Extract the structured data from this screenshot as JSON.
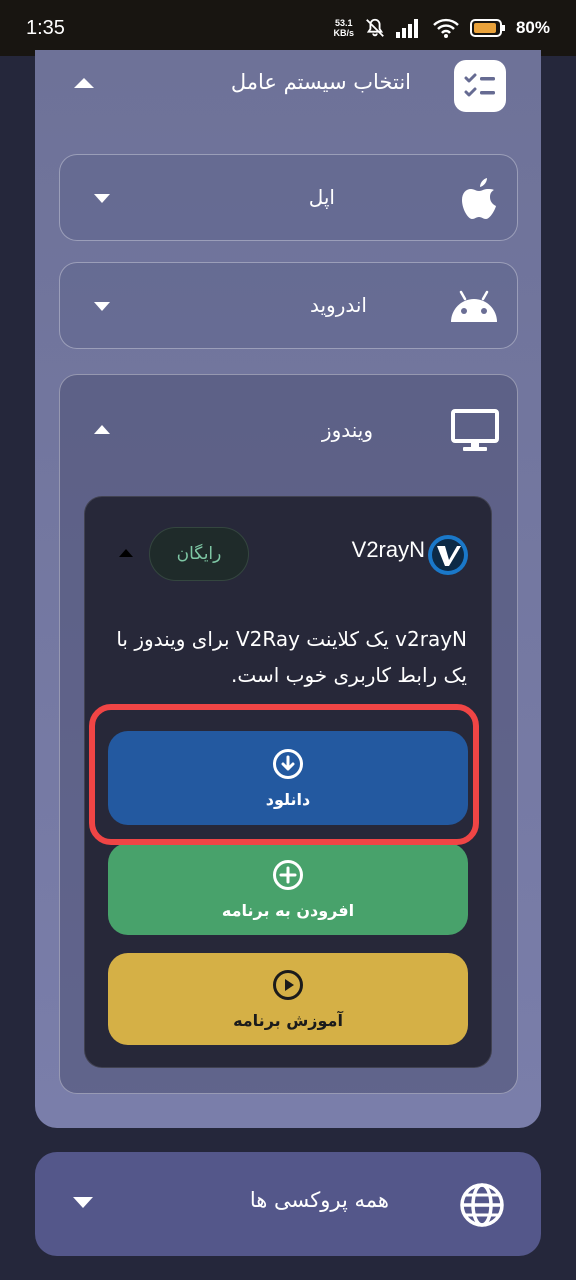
{
  "status_bar": {
    "time": "1:35",
    "speed_value": "53.1",
    "speed_unit": "KB/s",
    "battery": "80%"
  },
  "os_section": {
    "title": "انتخاب سیستم عامل",
    "icon": "checklist-icon",
    "expanded": true
  },
  "os_items": [
    {
      "label": "اپل",
      "icon": "apple-icon",
      "expanded": false
    },
    {
      "label": "اندروید",
      "icon": "android-icon",
      "expanded": false
    },
    {
      "label": "ویندوز",
      "icon": "monitor-icon",
      "expanded": true
    }
  ],
  "app": {
    "name": "V2rayN",
    "badge": "رایگان",
    "description": "v2rayN یک کلاینت V2Ray برای ویندوز با یک رابط کاربری خوب است.",
    "buttons": {
      "download": "دانلود",
      "add": "افرودن به برنامه",
      "tutorial": "آموزش برنامه"
    }
  },
  "proxies": {
    "label": "همه پروکسی ها",
    "icon": "globe-icon"
  },
  "colors": {
    "download": "#2359a0",
    "add": "#48a26b",
    "tutorial": "#d5b046",
    "highlight": "#f04545"
  }
}
